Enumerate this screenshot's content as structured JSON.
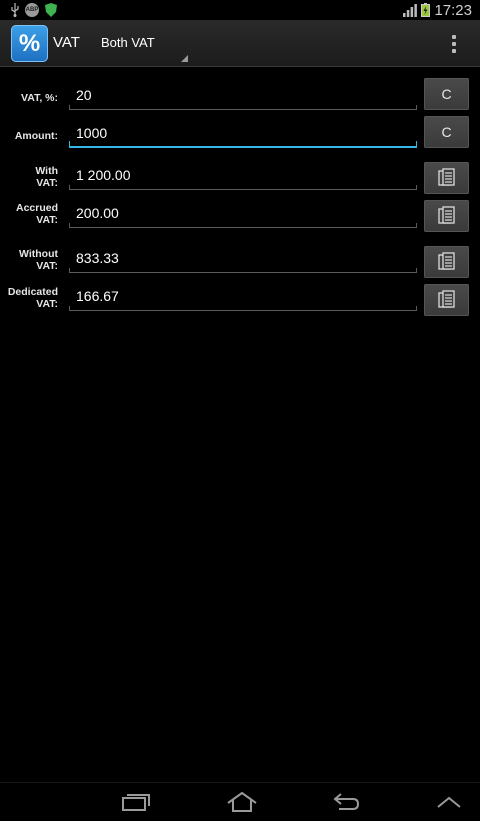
{
  "status_bar": {
    "time": "17:23",
    "icons": [
      "usb-icon",
      "app-notification-icon",
      "shield-icon",
      "signal-icon",
      "battery-charging-icon"
    ]
  },
  "action_bar": {
    "app_icon_glyph": "%",
    "title": "VAT",
    "mode_label": "Both VAT",
    "overflow_icon": "overflow-menu-icon"
  },
  "form": {
    "vat_rate": {
      "label": "VAT, %:",
      "value": "20",
      "action_label": "C"
    },
    "amount": {
      "label": "Amount:",
      "value": "1000",
      "action_label": "C"
    },
    "with_vat": {
      "label_line1": "With",
      "label_line2": "VAT:",
      "value": "1 200.00"
    },
    "accrued_vat": {
      "label_line1": "Accrued",
      "label_line2": "VAT:",
      "value": "200.00"
    },
    "without_vat": {
      "label_line1": "Without",
      "label_line2": "VAT:",
      "value": "833.33"
    },
    "dedicated_vat": {
      "label_line1": "Dedicated",
      "label_line2": "VAT:",
      "value": "166.67"
    }
  },
  "nav_bar": {
    "buttons": [
      "recent-apps-icon",
      "home-icon",
      "back-icon",
      "up-arrow-icon"
    ]
  },
  "colors": {
    "background": "#000000",
    "accent": "#33b5e5",
    "app_icon": "#2a86d6",
    "button": "#414141"
  }
}
